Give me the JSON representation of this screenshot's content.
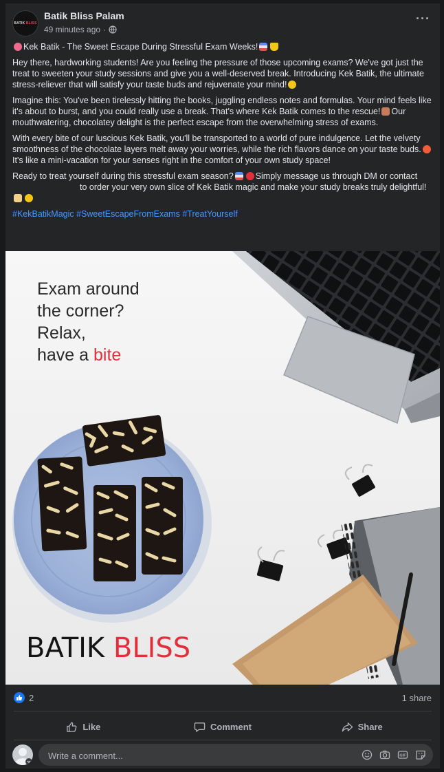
{
  "post": {
    "page_name": "Batik Bliss Palam",
    "avatar_text_a": "BATIK",
    "avatar_text_b": "BLISS",
    "time": "49 minutes ago",
    "more": "···",
    "title": "Kek Batik - The Sweet Escape During Stressful Exam Weeks!",
    "p1": "Hey there, hardworking students! Are you feeling the pressure of those upcoming exams? We've got just the treat to sweeten your study sessions and give you a well-deserved break. Introducing Kek Batik, the ultimate stress-reliever that will satisfy your taste buds and rejuvenate your mind!",
    "p2a": "Imagine this: You've been tirelessly hitting the books, juggling endless notes and formulas. Your mind feels like it's about to burst, and you could really use a break. That's where Kek Batik comes to the rescue!",
    "p2b": "Our mouthwatering, chocolatey delight is the perfect escape from the overwhelming stress of exams.",
    "p3a": "With every bite of our luscious Kek Batik, you'll be transported to a world of pure indulgence. Let the velvety smoothness of the chocolate layers melt away your worries, while the rich flavors dance on your taste buds.",
    "p3b": "It's like a mini-vacation for your senses right in the comfort of your own study space!",
    "p4a": "Ready to treat yourself during this stressful exam season?",
    "p4b": "Simply message us through DM or contact",
    "p4c": "to order your very own slice of Kek Batik magic and make your study breaks truly delightful!",
    "hashtags": "#KekBatikMagic #SweetEscapeFromExams #TreatYourself"
  },
  "image": {
    "headline_1": "Exam around",
    "headline_2": "the corner?",
    "headline_3": "Relax,",
    "headline_4a": "have a ",
    "headline_4b": "bite",
    "brand_a": "BATIK ",
    "brand_b": "BLISS",
    "accent_color": "#e0303b"
  },
  "stats": {
    "likes": "2",
    "shares": "1 share"
  },
  "actions": {
    "like": "Like",
    "comment": "Comment",
    "share": "Share"
  },
  "comment": {
    "placeholder": "Write a comment..."
  }
}
